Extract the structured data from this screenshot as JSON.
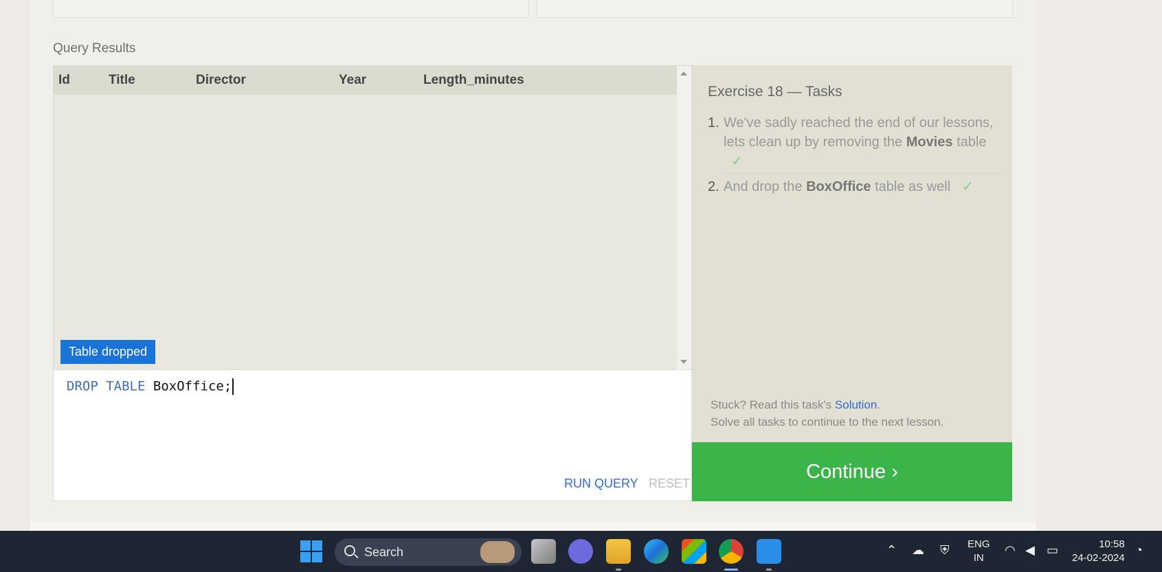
{
  "results": {
    "label": "Query Results",
    "columns": [
      "Id",
      "Title",
      "Director",
      "Year",
      "Length_minutes"
    ],
    "toast": "Table dropped"
  },
  "editor": {
    "kw1": "DROP",
    "kw2": "TABLE",
    "ident": "BoxOffice;",
    "run_label": "RUN QUERY",
    "reset_label": "RESET"
  },
  "tasks": {
    "title": "Exercise 18 — Tasks",
    "items": [
      {
        "num": "1.",
        "pre": "We've sadly reached the end of our lessons, lets clean up by removing the",
        "bold": "Movies",
        "post": "table",
        "check": "✓"
      },
      {
        "num": "2.",
        "pre": "And drop the",
        "bold": "BoxOffice",
        "post": "table as well",
        "check": "✓"
      }
    ],
    "stuck_pre": "Stuck? Read this task's",
    "solution_link": "Solution",
    "stuck_post": ".",
    "solve_all": "Solve all tasks to continue to the next lesson.",
    "continue_label": "Continue ›"
  },
  "taskbar": {
    "search_label": "Search",
    "lang_line1": "ENG",
    "lang_line2": "IN",
    "time": "10:58",
    "date": "24-02-2024"
  },
  "colors": {
    "accent_blue": "#1a73d9",
    "continue_green": "#3bb54a",
    "taskbar_bg": "#1f2633"
  }
}
